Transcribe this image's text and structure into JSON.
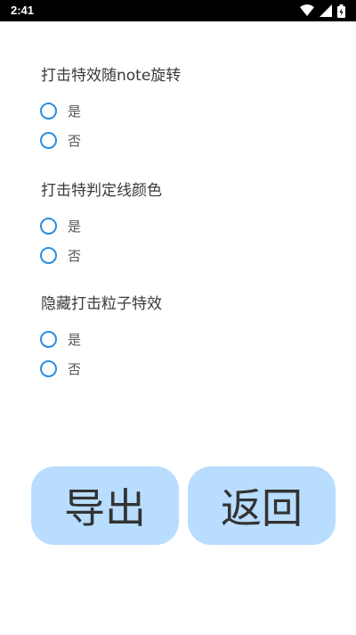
{
  "status_bar": {
    "time": "2:41",
    "icons": [
      "wifi-icon",
      "signal-icon",
      "battery-icon"
    ]
  },
  "settings": [
    {
      "title": "打击特效随note旋转",
      "options": [
        "是",
        "否"
      ]
    },
    {
      "title": "打击特判定线颜色",
      "options": [
        "是",
        "否"
      ]
    },
    {
      "title": "隐藏打击粒子特效",
      "options": [
        "是",
        "否"
      ]
    }
  ],
  "buttons": {
    "export_label": "导出",
    "back_label": "返回"
  },
  "colors": {
    "radio": "#2a8de0",
    "button_bg": "#b8ddff"
  }
}
